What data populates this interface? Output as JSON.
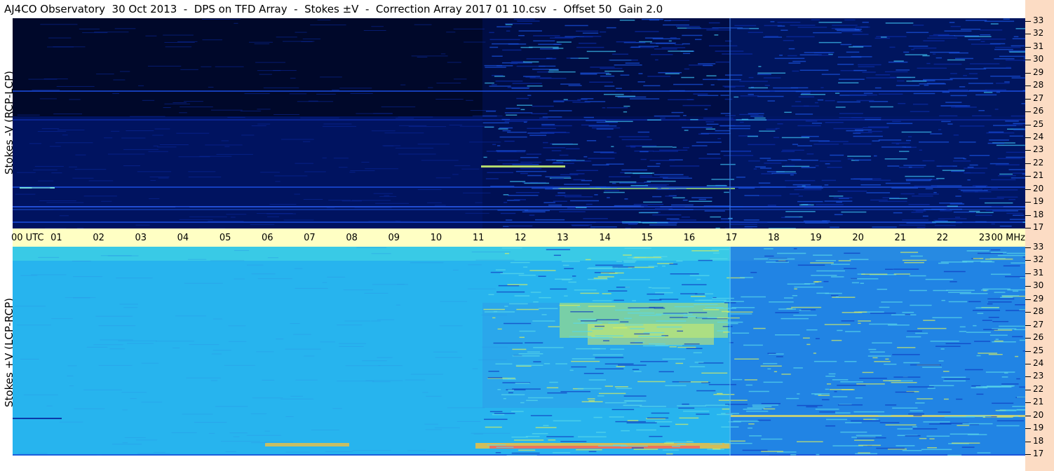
{
  "title": "AJ4CO Observatory  30 Oct 2013  -  DPS on TFD Array  -  Stokes ±V  -  Correction Array 2017 01 10.csv  -  Offset 50  Gain 2.0",
  "panels": {
    "top": {
      "ylabel": "Stokes -V (RCP-LCP)"
    },
    "bottom": {
      "ylabel": "Stokes +V (LCP-RCP)"
    }
  },
  "colors": {
    "top_background": "#000a2e",
    "bottom_background": "#27b4ee",
    "time_bar": "#ffffc4",
    "right_strip": "#fcdcc4"
  },
  "chart_data": {
    "type": "heatmap",
    "x_ticks": [
      "00 UTC",
      "01",
      "02",
      "03",
      "04",
      "05",
      "06",
      "07",
      "08",
      "09",
      "10",
      "11",
      "12",
      "13",
      "14",
      "15",
      "16",
      "17",
      "18",
      "19",
      "20",
      "21",
      "22",
      "23",
      "00 MHz"
    ],
    "xlim": [
      0,
      24
    ],
    "y_ticks": [
      "33",
      "32",
      "31",
      "30",
      "29",
      "28",
      "27",
      "26",
      "25",
      "24",
      "23",
      "22",
      "21",
      "20",
      "19",
      "18",
      "17"
    ],
    "ylim": [
      17,
      33
    ],
    "top_panel": "Stokes -V (RCP-LCP)",
    "bottom_panel": "Stokes +V (LCP-RCP)"
  }
}
